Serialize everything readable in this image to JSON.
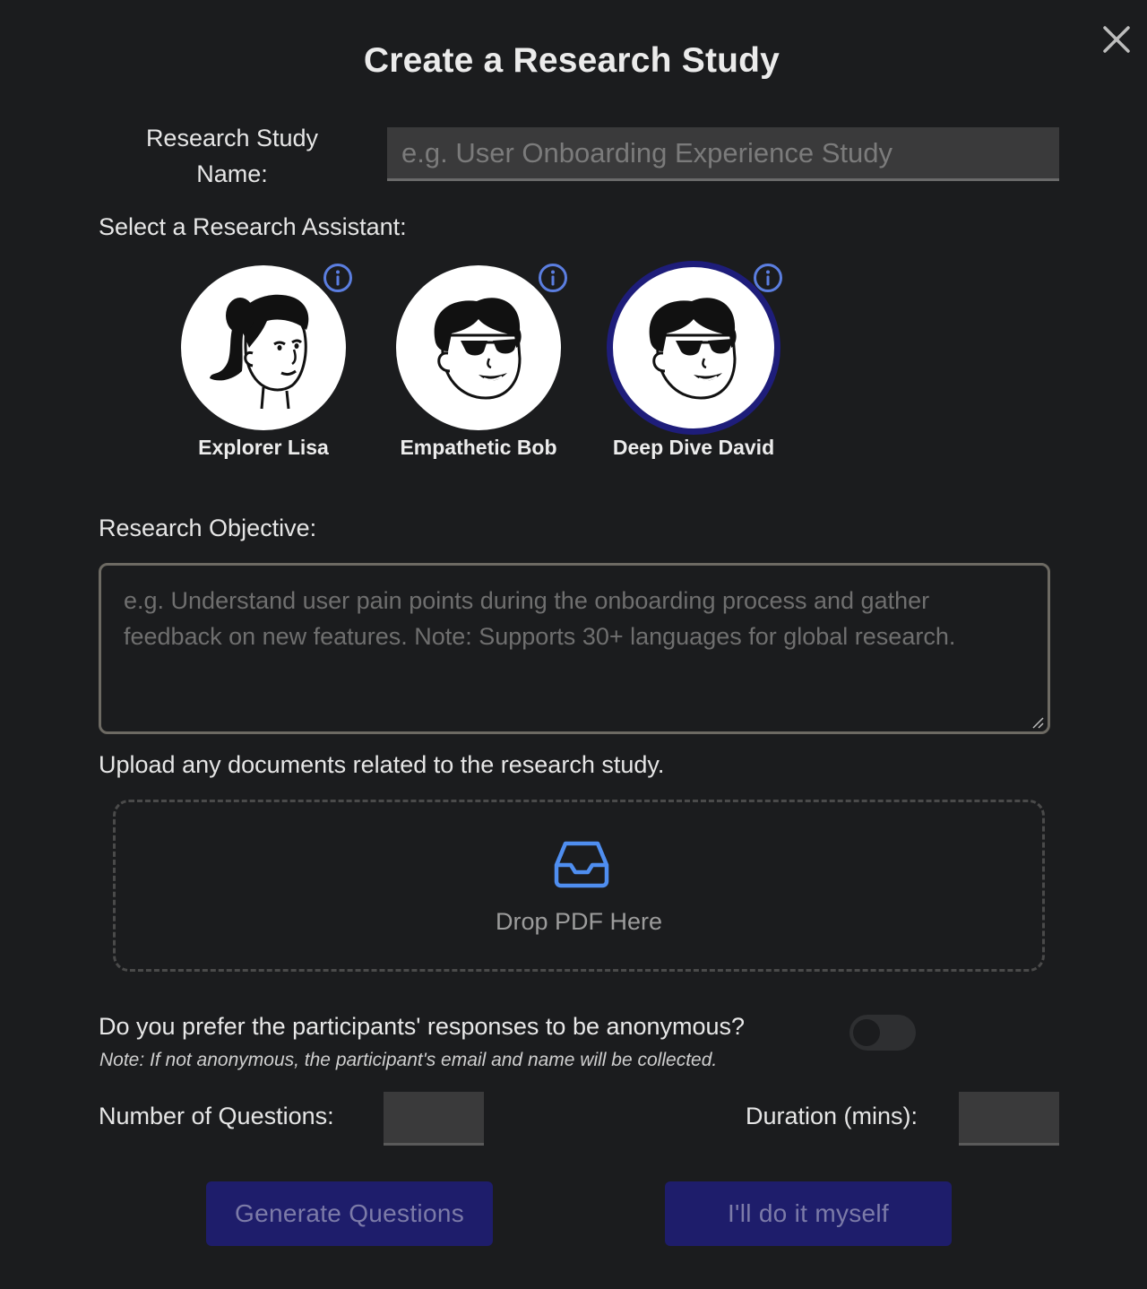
{
  "dialog": {
    "title": "Create a Research Study",
    "close_icon": "close-icon"
  },
  "study_name": {
    "label": "Research Study Name:",
    "placeholder": "e.g. User Onboarding Experience Study",
    "value": ""
  },
  "assistants": {
    "label": "Select a Research Assistant:",
    "selected": "Deep Dive David",
    "items": [
      {
        "name": "Explorer Lisa",
        "avatar": "woman-avatar",
        "info_icon": "info-icon"
      },
      {
        "name": "Empathetic Bob",
        "avatar": "man-sunglasses-avatar",
        "info_icon": "info-icon"
      },
      {
        "name": "Deep Dive David",
        "avatar": "man-sunglasses-avatar",
        "info_icon": "info-icon"
      }
    ]
  },
  "objective": {
    "label": "Research Objective:",
    "placeholder": "e.g. Understand user pain points during the onboarding process and gather feedback on new features. Note: Supports 30+ languages for global research.",
    "value": ""
  },
  "upload": {
    "label": "Upload any documents related to the research study.",
    "drop_text": "Drop PDF Here",
    "icon": "inbox-tray-icon"
  },
  "anonymous": {
    "question": "Do you prefer the participants' responses to be anonymous?",
    "note": "Note: If not anonymous, the participant's email and name will be collected.",
    "enabled": false
  },
  "settings": {
    "questions_label": "Number of Questions:",
    "questions_value": "",
    "duration_label": "Duration (mins):",
    "duration_value": ""
  },
  "actions": {
    "generate_label": "Generate Questions",
    "manual_label": "I'll do it myself"
  },
  "colors": {
    "background": "#1b1c1e",
    "accent_info": "#5b7ee0",
    "selected_ring": "#1e1d7a",
    "button_bg": "#1e1d6b",
    "icon_blue": "#4f8ef0"
  }
}
